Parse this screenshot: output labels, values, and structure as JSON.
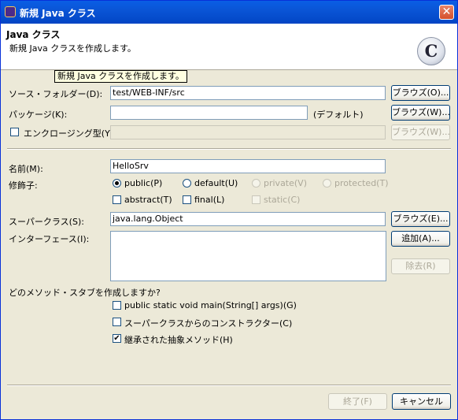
{
  "window": {
    "title": "新規 Java クラス",
    "close_label": "✕"
  },
  "banner": {
    "heading": "Java クラス",
    "description": "新規 Java クラスを作成します。",
    "icon_letter": "C",
    "tooltip": "新規 Java クラスを作成します。"
  },
  "source_folder": {
    "label": "ソース・フォルダー(D):",
    "value": "test/WEB-INF/src",
    "browse_label": "ブラウズ(O)..."
  },
  "package": {
    "label": "パッケージ(K):",
    "value": "",
    "default_note": "(デフォルト)",
    "browse_label": "ブラウズ(W)..."
  },
  "enclosing": {
    "label": "エンクロージング型(Y):",
    "value": "",
    "browse_label": "ブラウズ(W)..."
  },
  "name": {
    "label": "名前(M):",
    "value": "HelloSrv"
  },
  "modifiers": {
    "label": "修飾子:",
    "public": "public(P)",
    "default": "default(U)",
    "private": "private(V)",
    "protected": "protected(T)",
    "abstract": "abstract(T)",
    "final": "final(L)",
    "static": "static(C)",
    "selected": "public(P)"
  },
  "superclass": {
    "label": "スーパークラス(S):",
    "value": "java.lang.Object",
    "browse_label": "ブラウズ(E)..."
  },
  "interfaces": {
    "label": "インターフェース(I):",
    "add_label": "追加(A)...",
    "remove_label": "除去(R)"
  },
  "stubs": {
    "question": "どのメソッド・スタブを作成しますか?",
    "main": "public static void main(String[] args)(G)",
    "constructors": "スーパークラスからのコンストラクター(C)",
    "inherited": "継承された抽象メソッド(H)",
    "checked_mark": "✔"
  },
  "footer": {
    "finish_label": "終了(F)",
    "cancel_label": "キャンセル"
  }
}
